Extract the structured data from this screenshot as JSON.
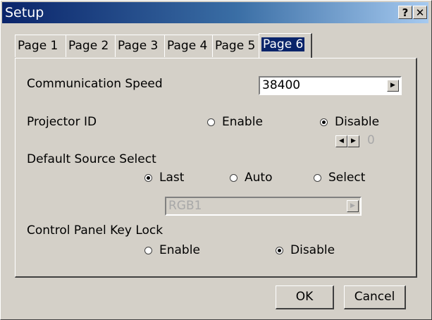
{
  "window": {
    "title": "Setup",
    "help_label": "?",
    "close_label": "✕"
  },
  "tabs": [
    {
      "label": "Page 1"
    },
    {
      "label": "Page 2"
    },
    {
      "label": "Page 3"
    },
    {
      "label": "Page 4"
    },
    {
      "label": "Page 5"
    },
    {
      "label": "Page 6"
    }
  ],
  "active_tab": "Page 6",
  "comm_speed": {
    "label": "Communication Speed",
    "value": "38400",
    "arrow": "▶"
  },
  "projector_id": {
    "label": "Projector ID",
    "enable": "Enable",
    "disable": "Disable",
    "selected": "Disable",
    "left_arrow": "◀",
    "right_arrow": "▶",
    "value": "0"
  },
  "default_source": {
    "label": "Default Source Select",
    "last": "Last",
    "auto": "Auto",
    "select": "Select",
    "selected": "Last",
    "combo_value": "RGB1",
    "arrow": "▶"
  },
  "key_lock": {
    "label": "Control Panel Key Lock",
    "enable": "Enable",
    "disable": "Disable",
    "selected": "Disable"
  },
  "buttons": {
    "ok": "OK",
    "cancel": "Cancel"
  }
}
